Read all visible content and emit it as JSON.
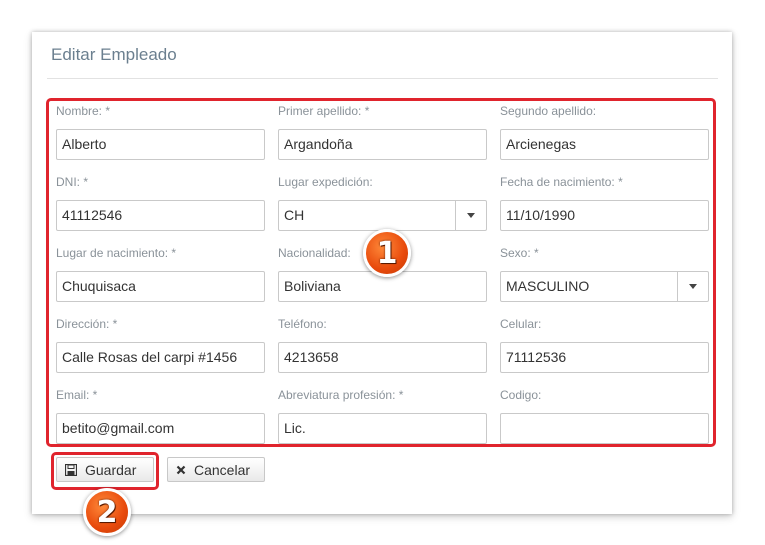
{
  "dialog": {
    "title": "Editar Empleado"
  },
  "fields": {
    "nombre": {
      "label": "Nombre:  *",
      "value": "Alberto"
    },
    "primer_apellido": {
      "label": "Primer apellido:  *",
      "value": "Argandoña"
    },
    "segundo_apellido": {
      "label": "Segundo apellido:",
      "value": "Arcienegas"
    },
    "dni": {
      "label": "DNI:  *",
      "value": "41112546"
    },
    "lugar_expedicion": {
      "label": "Lugar expedición:",
      "value": "CH"
    },
    "fecha_nacimiento": {
      "label": "Fecha de nacimiento:  *",
      "value": "11/10/1990"
    },
    "lugar_nacimiento": {
      "label": "Lugar de nacimiento:  *",
      "value": "Chuquisaca"
    },
    "nacionalidad": {
      "label": "Nacionalidad:",
      "value": "Boliviana"
    },
    "sexo": {
      "label": "Sexo:  *",
      "value": "MASCULINO"
    },
    "direccion": {
      "label": "Dirección:  *",
      "value": "Calle Rosas del carpi #1456"
    },
    "telefono": {
      "label": "Teléfono:",
      "value": "4213658"
    },
    "celular": {
      "label": "Celular:",
      "value": "71112536"
    },
    "email": {
      "label": "Email:  *",
      "value": "betito@gmail.com"
    },
    "abreviatura": {
      "label": "Abreviatura profesión:  *",
      "value": "Lic."
    },
    "codigo": {
      "label": "Codigo:",
      "value": ""
    }
  },
  "buttons": {
    "save_label": "Guardar",
    "cancel_label": "Cancelar"
  },
  "annotations": {
    "badge_1": "1",
    "badge_2": "2"
  },
  "colors": {
    "annotation": "#e0242d",
    "badge": "#e84a0c",
    "label": "#8a9299",
    "title": "#6b7f8f"
  }
}
